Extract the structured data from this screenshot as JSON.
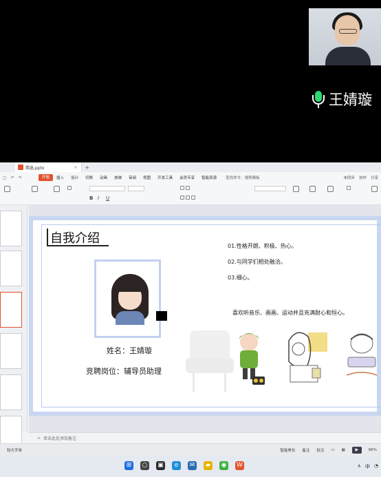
{
  "video": {
    "speaker_name": "王婧璇"
  },
  "app": {
    "tab_title": "简选.pptx",
    "menu": [
      "开始",
      "插入",
      "设计",
      "切换",
      "动画",
      "放映",
      "审阅",
      "视图",
      "开发工具",
      "会员专享",
      "智能资源"
    ],
    "active_menu": "开始",
    "search_text": "查找命令、搜索模板",
    "right_menu": [
      "未同步",
      "协作",
      "分享"
    ]
  },
  "slide": {
    "title": "自我介绍",
    "name_line": "姓名：王婧璇",
    "job_line": "竞聘岗位：辅导员助理",
    "points": [
      "01.性格开朗、积极、热心。",
      "02.与同学们相处融洽。",
      "03.细心。"
    ],
    "hobby": "喜欢听音乐、画画、运动并且充满耐心和恒心。"
  },
  "notes_placeholder": "单击此处添加备注",
  "status": {
    "left": "较大字体",
    "smart": "智能美化",
    "notes": "备注",
    "comments": "批注",
    "zoom": "86%"
  },
  "taskbar": {
    "icons": [
      "windows-icon",
      "search-icon",
      "taskview-icon",
      "edge-icon",
      "mail-icon",
      "explorer-icon",
      "wechat-icon",
      "wps-icon"
    ],
    "tray": [
      "∧",
      "中"
    ]
  }
}
